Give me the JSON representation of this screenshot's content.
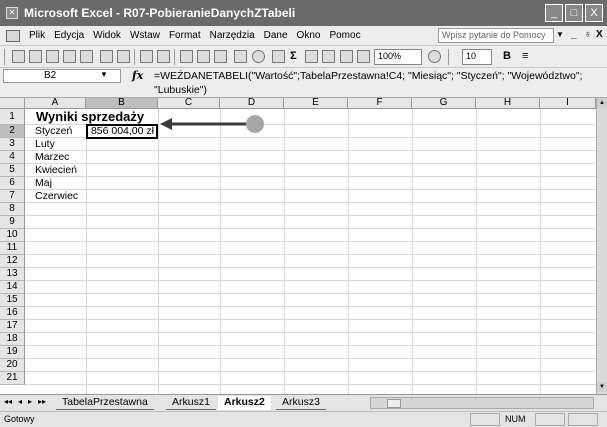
{
  "window": {
    "title": "Microsoft Excel - R07-PobieranieDanychZTabeli",
    "app_icon": "✕",
    "controls": [
      "_",
      "□",
      "X"
    ]
  },
  "menu": {
    "items": [
      "Plik",
      "Edycja",
      "Widok",
      "Wstaw",
      "Format",
      "Narzędzia",
      "Dane",
      "Okno",
      "Pomoc"
    ],
    "help_placeholder": "Wpisz pytanie do Pomocy",
    "doc_controls": [
      "_",
      "♁",
      "X"
    ]
  },
  "toolbar": {
    "zoom": "100%",
    "font_size": "10",
    "bold": "B",
    "sum": "Σ",
    "align": "≡"
  },
  "formula_bar": {
    "name_box": "B2",
    "fx": "fx",
    "formula_line1": "=WEŹDANETABELI(\"Wartość\";TabelaPrzestawna!C4; \"Miesiąc\"; \"Styczeń\"; \"Województwo\";",
    "formula_line2": "\"Lubuskie\")"
  },
  "grid": {
    "columns": [
      "A",
      "B",
      "C",
      "D",
      "E",
      "F",
      "G",
      "H",
      "I"
    ],
    "rows": [
      "1",
      "2",
      "3",
      "4",
      "5",
      "6",
      "7",
      "8",
      "9",
      "10",
      "11",
      "12",
      "13",
      "14",
      "15",
      "16",
      "17",
      "18",
      "19",
      "20",
      "21"
    ],
    "title": "Wyniki sprzedaży",
    "months": [
      "Styczeń",
      "Luty",
      "Marzec",
      "Kwiecień",
      "Maj",
      "Czerwiec"
    ],
    "b2_value": "856 004,00 zł"
  },
  "sheets": {
    "nav": [
      "◂◂",
      "◂",
      "▸",
      "▸▸"
    ],
    "tabs": [
      "TabelaPrzestawna",
      "Arkusz1",
      "Arkusz2",
      "Arkusz3"
    ],
    "active": "Arkusz2"
  },
  "status": {
    "ready": "Gotowy",
    "num": "NUM"
  },
  "colors": {
    "callout": "#a6a6a6",
    "arrow": "#3c3c3c"
  }
}
